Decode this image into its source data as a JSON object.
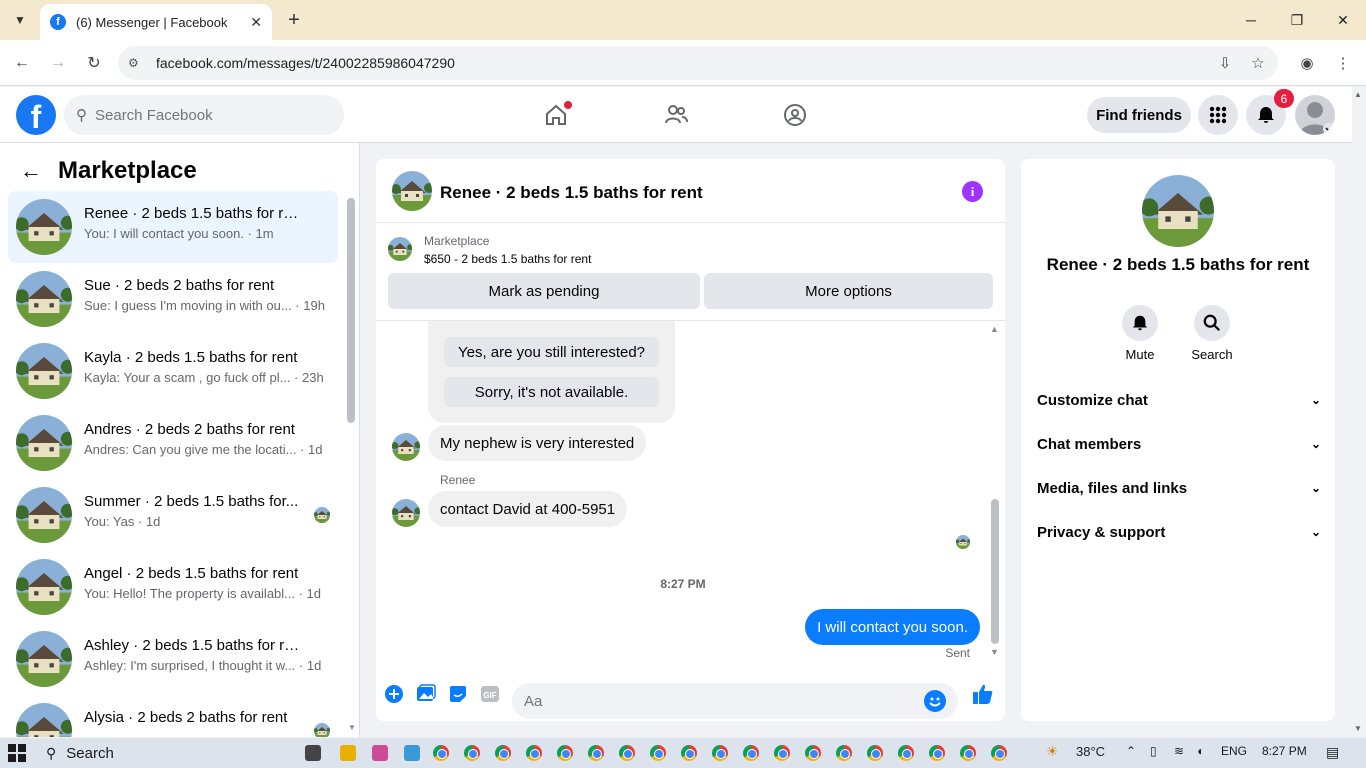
{
  "browser": {
    "tab_title": "(6) Messenger | Facebook",
    "url": "facebook.com/messages/t/24002285986047290",
    "favicon": "f"
  },
  "fb": {
    "logo": "f",
    "search_placeholder": "Search Facebook",
    "find_friends": "Find friends",
    "notification_count": "6"
  },
  "sidebar": {
    "title": "Marketplace",
    "conversations": [
      {
        "name": "Renee · 2 beds 1.5 baths for rent",
        "preview": "You: I will contact you soon. · 1m"
      },
      {
        "name": "Sue · 2 beds 2 baths for rent",
        "preview": "Sue: I guess I'm moving in with ou... · 19h"
      },
      {
        "name": "Kayla · 2 beds 1.5 baths for rent",
        "preview": "Kayla: Your a scam , go fuck off pl... · 23h"
      },
      {
        "name": "Andres · 2 beds 2 baths for rent",
        "preview": "Andres: Can you give me the locati... · 1d"
      },
      {
        "name": "Summer · 2 beds 1.5 baths for...",
        "preview": "You: Yas · 1d"
      },
      {
        "name": "Angel · 2 beds 1.5 baths for rent",
        "preview": "You: Hello! The property is availabl... · 1d"
      },
      {
        "name": "Ashley · 2 beds 1.5 baths for rent",
        "preview": "Ashley: I'm surprised, I thought it w... · 1d"
      },
      {
        "name": "Alysia · 2 beds 2 baths for rent",
        "preview": ""
      }
    ]
  },
  "chat": {
    "title": "Renee · 2 beds 1.5 baths for rent",
    "marketplace_label": "Marketplace",
    "listing": "$650 - 2 beds 1.5 baths for rent",
    "mark_pending": "Mark as pending",
    "more_options": "More options",
    "quick_reply_1": "Yes, are you still interested?",
    "quick_reply_2": "Sorry, it's not available.",
    "msg_1": "My nephew is very interested",
    "sender": "Renee",
    "msg_2": "contact  David at 400-5951",
    "time": "8:27 PM",
    "msg_out": "I will contact you soon.",
    "status": "Sent",
    "composer_placeholder": "Aa"
  },
  "info": {
    "name": "Renee · 2 beds 1.5 baths for rent",
    "mute": "Mute",
    "search": "Search",
    "rows": [
      "Customize chat",
      "Chat members",
      "Media, files and links",
      "Privacy & support"
    ]
  },
  "taskbar": {
    "search": "Search",
    "temp": "38°C",
    "lang": "ENG",
    "clock": "8:27 PM"
  },
  "colors": {
    "fb_blue": "#1877f2",
    "messenger_blue": "#0a7cff",
    "info_purple": "#a033ff",
    "badge_red": "#e41e3f"
  }
}
